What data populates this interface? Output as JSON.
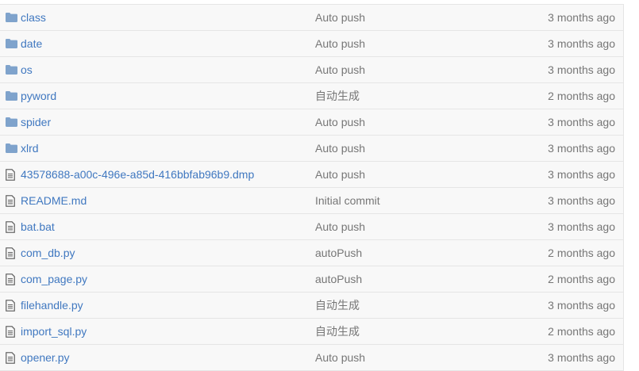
{
  "colors": {
    "link": "#4078c0",
    "muted": "#767676",
    "folder_icon": "#7fa3cc",
    "file_icon": "#6a6a6a",
    "row_bg": "#f8f8f8",
    "border": "#e5e5e5"
  },
  "files": [
    {
      "type": "directory",
      "icon": "folder-icon",
      "name": "class",
      "message": "Auto push",
      "age": "3 months ago"
    },
    {
      "type": "directory",
      "icon": "folder-icon",
      "name": "date",
      "message": "Auto push",
      "age": "3 months ago"
    },
    {
      "type": "directory",
      "icon": "folder-icon",
      "name": "os",
      "message": "Auto push",
      "age": "3 months ago"
    },
    {
      "type": "directory",
      "icon": "folder-icon",
      "name": "pyword",
      "message": "自动生成",
      "age": "2 months ago"
    },
    {
      "type": "directory",
      "icon": "folder-icon",
      "name": "spider",
      "message": "Auto push",
      "age": "3 months ago"
    },
    {
      "type": "directory",
      "icon": "folder-icon",
      "name": "xlrd",
      "message": "Auto push",
      "age": "3 months ago"
    },
    {
      "type": "file",
      "icon": "file-icon",
      "name": "43578688-a00c-496e-a85d-416bbfab96b9.dmp",
      "message": "Auto push",
      "age": "3 months ago"
    },
    {
      "type": "file",
      "icon": "file-icon",
      "name": "README.md",
      "message": "Initial commit",
      "age": "3 months ago"
    },
    {
      "type": "file",
      "icon": "file-icon",
      "name": "bat.bat",
      "message": "Auto push",
      "age": "3 months ago"
    },
    {
      "type": "file",
      "icon": "file-icon",
      "name": "com_db.py",
      "message": "autoPush",
      "age": "2 months ago"
    },
    {
      "type": "file",
      "icon": "file-icon",
      "name": "com_page.py",
      "message": "autoPush",
      "age": "2 months ago"
    },
    {
      "type": "file",
      "icon": "file-icon",
      "name": "filehandle.py",
      "message": "自动生成",
      "age": "3 months ago"
    },
    {
      "type": "file",
      "icon": "file-icon",
      "name": "import_sql.py",
      "message": "自动生成",
      "age": "2 months ago"
    },
    {
      "type": "file",
      "icon": "file-icon",
      "name": "opener.py",
      "message": "Auto push",
      "age": "3 months ago"
    }
  ]
}
